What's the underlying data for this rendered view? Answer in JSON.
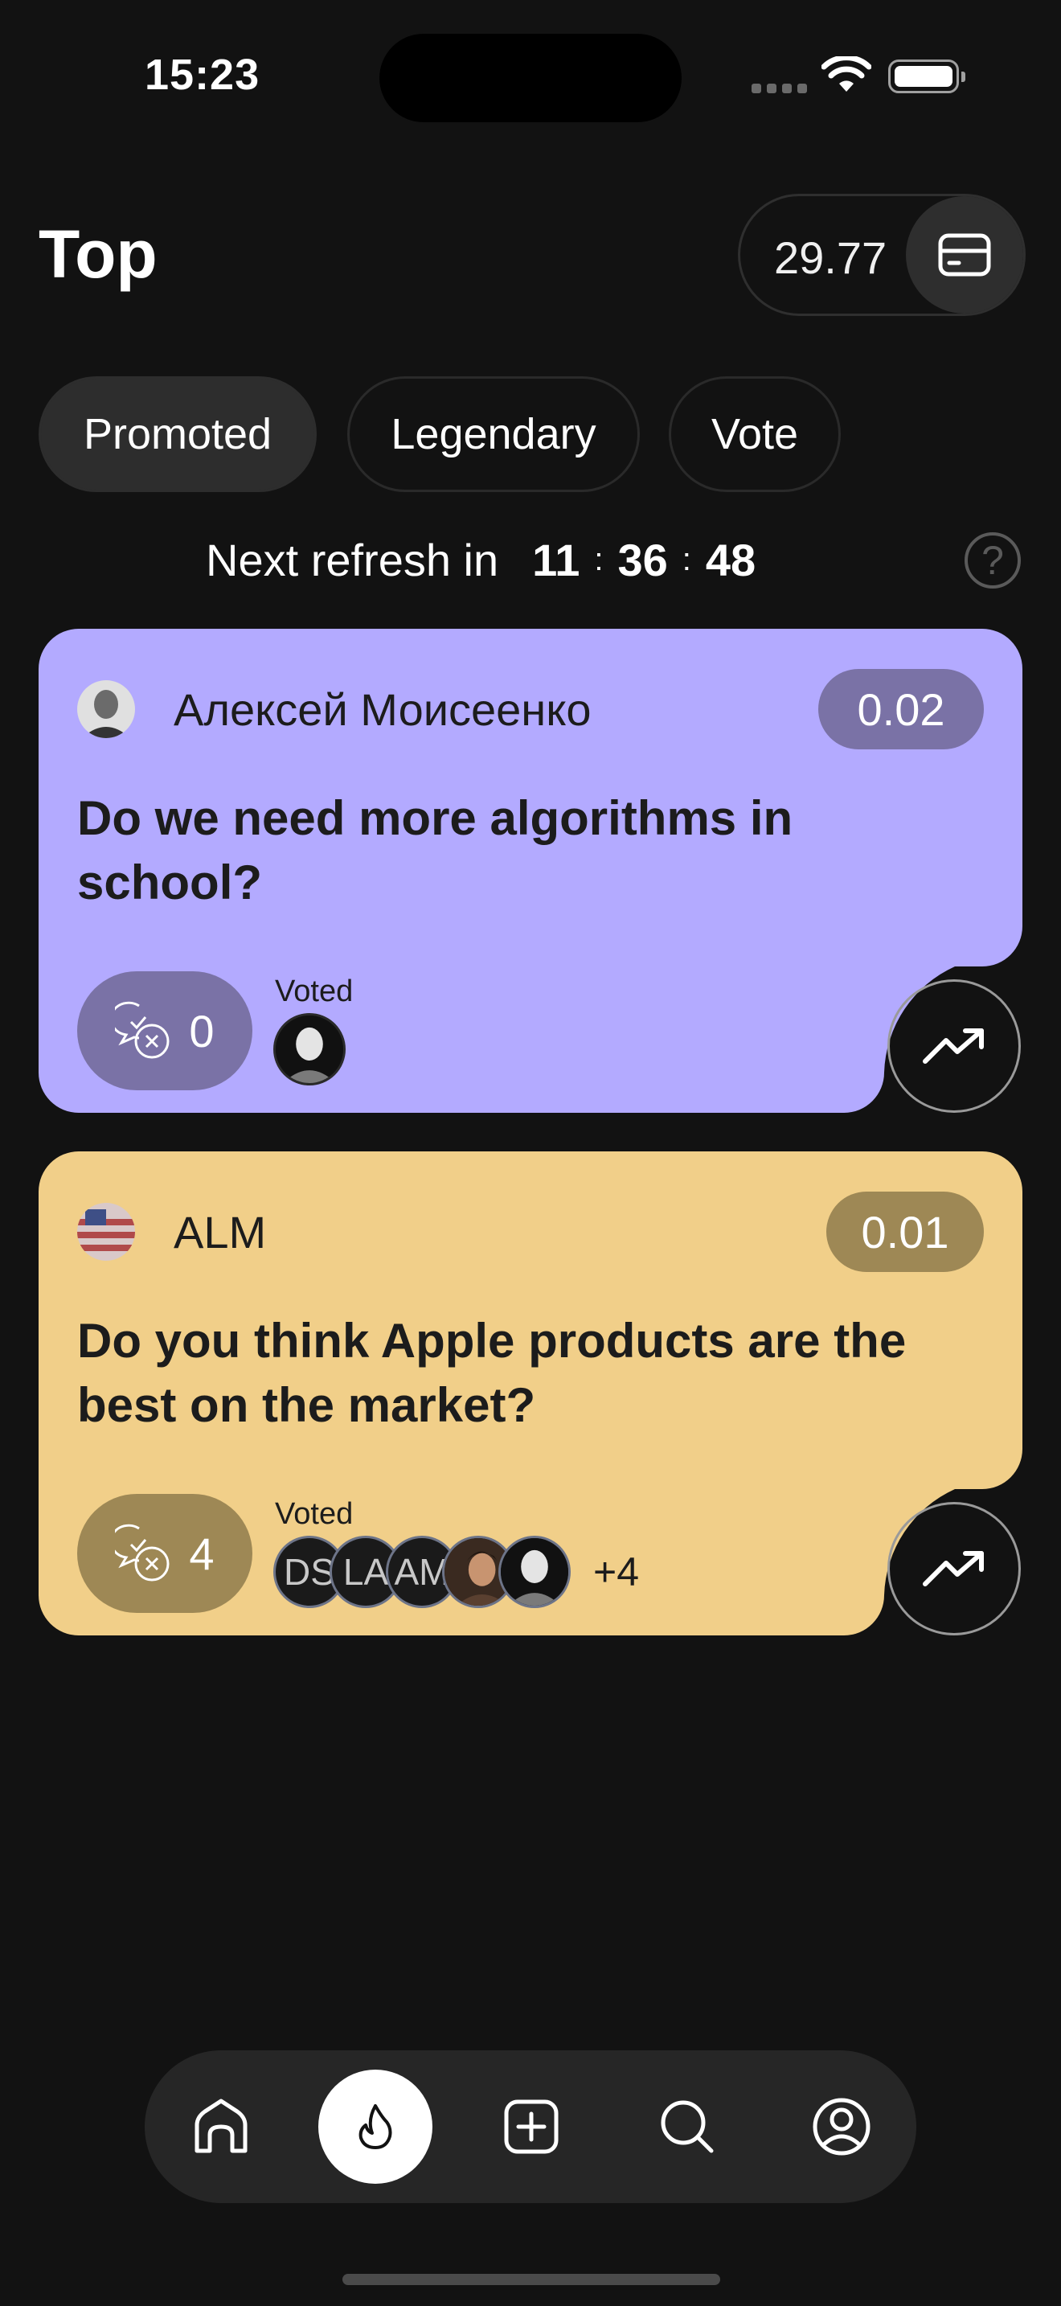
{
  "status_bar": {
    "time": "15:23"
  },
  "header": {
    "title": "Top",
    "balance": "29.77",
    "wallet_icon": "card-icon"
  },
  "tabs": [
    {
      "label": "Promoted",
      "active": true
    },
    {
      "label": "Legendary",
      "active": false
    },
    {
      "label": "Vote",
      "active": false
    }
  ],
  "refresh": {
    "label": "Next refresh in",
    "hours": "11",
    "minutes": "36",
    "seconds": "48",
    "separator": ":",
    "help": "?"
  },
  "cards": [
    {
      "author": "Алексей Моисеенко",
      "reward": "0.02",
      "question": "Do we need more algorithms in school?",
      "comments": "0",
      "voted_label": "Voted",
      "voters": [],
      "more": "",
      "color": "#b3aaff",
      "pill_color": "#7a72a6"
    },
    {
      "author": "ALM",
      "reward": "0.01",
      "question": "Do you think Apple products are the best on the market?",
      "comments": "4",
      "voted_label": "Voted",
      "voters": [
        "DS",
        "LA",
        "AM"
      ],
      "more": "+4",
      "color": "#f1cf89",
      "pill_color": "#9e8855"
    }
  ],
  "nav": {
    "items": [
      {
        "icon": "home-icon",
        "active": false
      },
      {
        "icon": "flame-icon",
        "active": true
      },
      {
        "icon": "add-icon",
        "active": false
      },
      {
        "icon": "search-icon",
        "active": false
      },
      {
        "icon": "profile-icon",
        "active": false
      }
    ]
  }
}
